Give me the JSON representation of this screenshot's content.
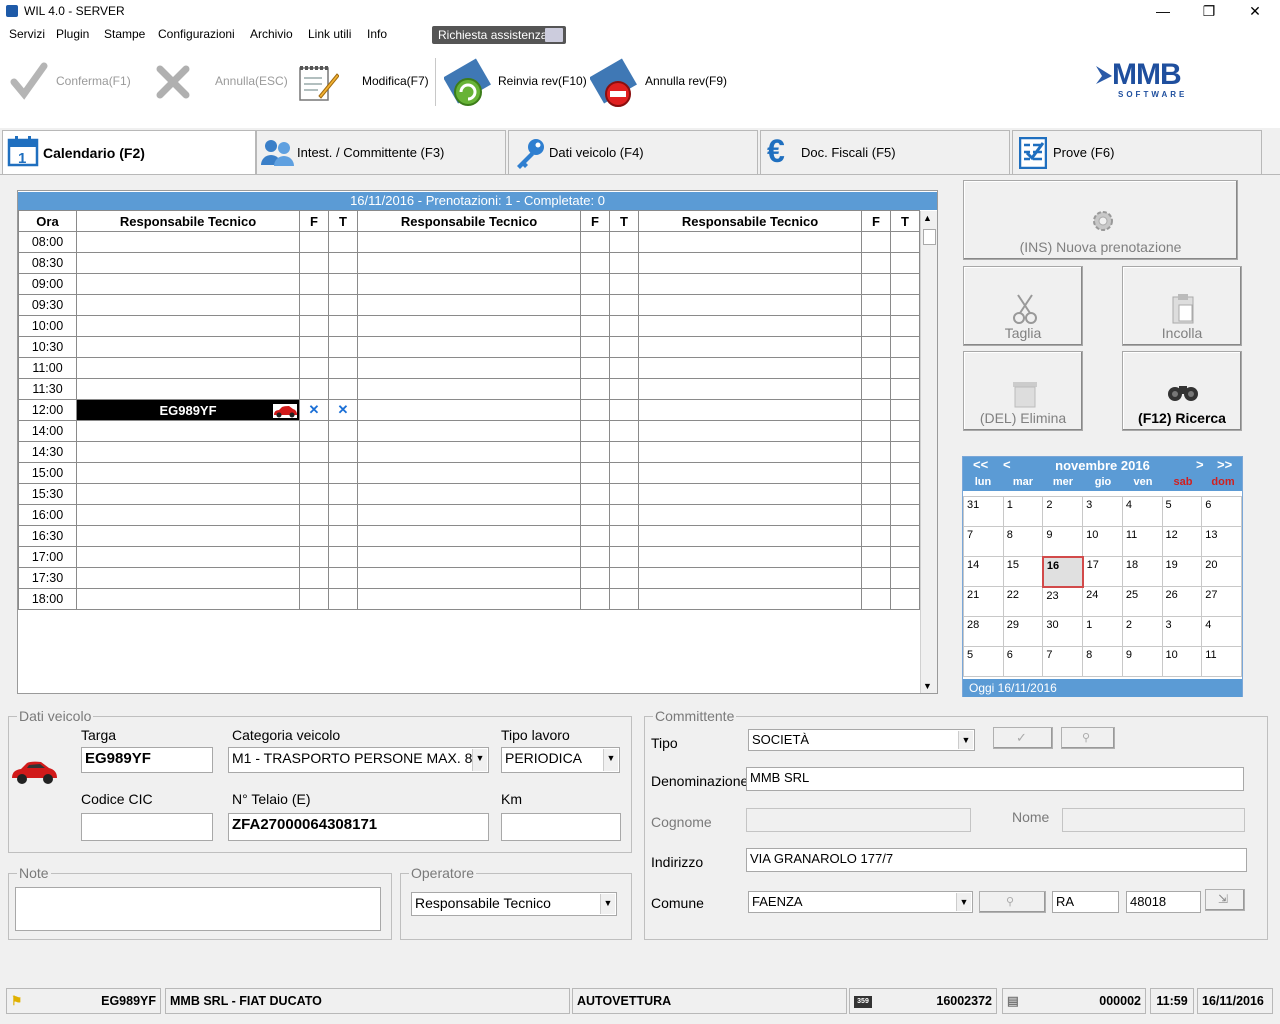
{
  "window": {
    "title": "WIL 4.0 - SERVER",
    "minimize": "—",
    "maximize": "❐",
    "close": "✕"
  },
  "menu": {
    "items": [
      "Servizi",
      "Plugin",
      "Stampe",
      "Configurazioni",
      "Archivio",
      "Link utili",
      "Info"
    ],
    "assistance": "Richiesta assistenza"
  },
  "toolbar": {
    "confirm": "Conferma(F1)",
    "cancel": "Annulla(ESC)",
    "edit": "Modifica(F7)",
    "resend": "Reinvia rev(F10)",
    "cancel_rev": "Annulla rev(F9)",
    "logo_main": "MMB",
    "logo_sub": "SOFTWARE"
  },
  "tabs": [
    {
      "label": "Calendario (F2)",
      "icon": "calendar-icon",
      "icon_text": "1"
    },
    {
      "label": "Intest. / Committente (F3)",
      "icon": "people-icon"
    },
    {
      "label": "Dati veicolo (F4)",
      "icon": "key-icon"
    },
    {
      "label": "Doc. Fiscali (F5)",
      "icon": "euro-icon",
      "icon_text": "€"
    },
    {
      "label": "Prove (F6)",
      "icon": "checklist-icon"
    }
  ],
  "schedule": {
    "header": "16/11/2016 - Prenotazioni: 1 - Completate: 0",
    "columns": {
      "time": "Ora",
      "tech": "Responsabile Tecnico",
      "f": "F",
      "t": "T"
    },
    "times": [
      "08:00",
      "08:30",
      "09:00",
      "09:30",
      "10:00",
      "10:30",
      "11:00",
      "11:30",
      "12:00",
      "14:00",
      "14:30",
      "15:00",
      "15:30",
      "16:00",
      "16:30",
      "17:00",
      "17:30",
      "18:00"
    ],
    "booking": {
      "time": "12:00",
      "plate": "EG989YF",
      "f_mark": "✕",
      "t_mark": "✕"
    }
  },
  "actions": {
    "new_booking": "(INS) Nuova prenotazione",
    "cut": "Taglia",
    "paste": "Incolla",
    "delete": "(DEL)  Elimina",
    "search": "(F12) Ricerca"
  },
  "calendar": {
    "prev_year": "<<",
    "prev_month": "<",
    "month": "novembre 2016",
    "next_month": ">",
    "next_year": ">>",
    "weekdays": [
      "lun",
      "mar",
      "mer",
      "gio",
      "ven",
      "sab",
      "dom"
    ],
    "weeks": [
      [
        "31",
        "1",
        "2",
        "3",
        "4",
        "5",
        "6"
      ],
      [
        "7",
        "8",
        "9",
        "10",
        "11",
        "12",
        "13"
      ],
      [
        "14",
        "15",
        "16",
        "17",
        "18",
        "19",
        "20"
      ],
      [
        "21",
        "22",
        "23",
        "24",
        "25",
        "26",
        "27"
      ],
      [
        "28",
        "29",
        "30",
        "1",
        "2",
        "3",
        "4"
      ],
      [
        "5",
        "6",
        "7",
        "8",
        "9",
        "10",
        "11"
      ]
    ],
    "selected_day": "16",
    "today": "Oggi 16/11/2016",
    "weekend_color": "#d02020"
  },
  "vehicle": {
    "group_label": "Dati veicolo",
    "plate_label": "Targa",
    "plate": "EG989YF",
    "category_label": "Categoria veicolo",
    "category": "M1 - TRASPORTO PERSONE MAX. 8",
    "work_type_label": "Tipo lavoro",
    "work_type": "PERIODICA",
    "cic_label": "Codice CIC",
    "cic": "",
    "chassis_label": "N° Telaio (E)",
    "chassis": "ZFA27000064308171",
    "km_label": "Km",
    "km": ""
  },
  "notes": {
    "label": "Note",
    "value": ""
  },
  "operator": {
    "label": "Operatore",
    "value": "Responsabile Tecnico"
  },
  "customer": {
    "group_label": "Committente",
    "type_label": "Tipo",
    "type": "SOCIETÀ",
    "name_label": "Denominazione",
    "name": "MMB SRL",
    "surname_label": "Cognome",
    "surname": "",
    "firstname_label": "Nome",
    "firstname": "",
    "address_label": "Indirizzo",
    "address": "VIA GRANAROLO 177/7",
    "city_label": "Comune",
    "city": "FAENZA",
    "province": "RA",
    "zip": "48018"
  },
  "status": {
    "plate": "EG989YF",
    "customer_vehicle": "MMB SRL - FIAT DUCATO",
    "vehicle_type": "AUTOVETTURA",
    "code1": "16002372",
    "code2": "000002",
    "time": "11:59",
    "date": "16/11/2016",
    "badge": "359"
  }
}
